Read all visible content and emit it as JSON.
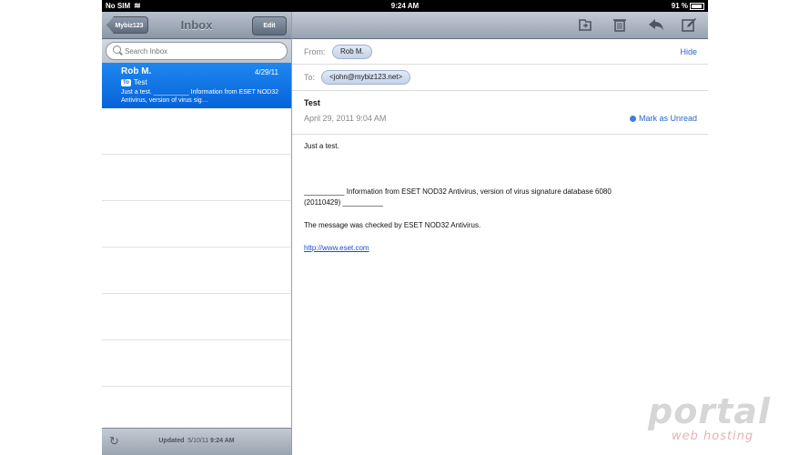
{
  "status": {
    "carrier": "No SIM",
    "time": "9:24 AM",
    "battery": "91 %"
  },
  "left": {
    "back_label": "Mybiz123",
    "title": "Inbox",
    "edit_label": "Edit",
    "search_placeholder": "Search Inbox",
    "messages": [
      {
        "from": "Rob M.",
        "date": "4/29/11",
        "to_badge": "To",
        "subject": "Test",
        "preview": "Just a test. __________ Information from ESET NOD32 Antivirus, version of virus sig…",
        "selected": true
      }
    ],
    "updated_prefix": "Updated",
    "updated_date": "5/10/11",
    "updated_time": "9:24 AM"
  },
  "toolbar": {
    "icons": [
      "folder-move-icon",
      "trash-icon",
      "reply-icon",
      "compose-icon"
    ]
  },
  "message": {
    "from_label": "From:",
    "from_name": "Rob M.",
    "hide_label": "Hide",
    "to_label": "To:",
    "to_address": "<john@mybiz123.net>",
    "subject": "Test",
    "date": "April 29, 2011 9:04 AM",
    "mark_unread": "Mark as Unread",
    "body_line1": "Just a test.",
    "body_line2": "__________ Information from ESET NOD32 Antivirus, version of virus signature database 6080",
    "body_line3": "(20110429) __________",
    "body_line4": "The message was checked by ESET NOD32 Antivirus.",
    "body_link": "http://www.eset.com"
  },
  "watermark": {
    "top": "portal",
    "bottom": "web hosting"
  },
  "colors": {
    "selected_row": "#0a6be0",
    "link": "#2a66c8",
    "unread_dot": "#3d7fe0"
  }
}
